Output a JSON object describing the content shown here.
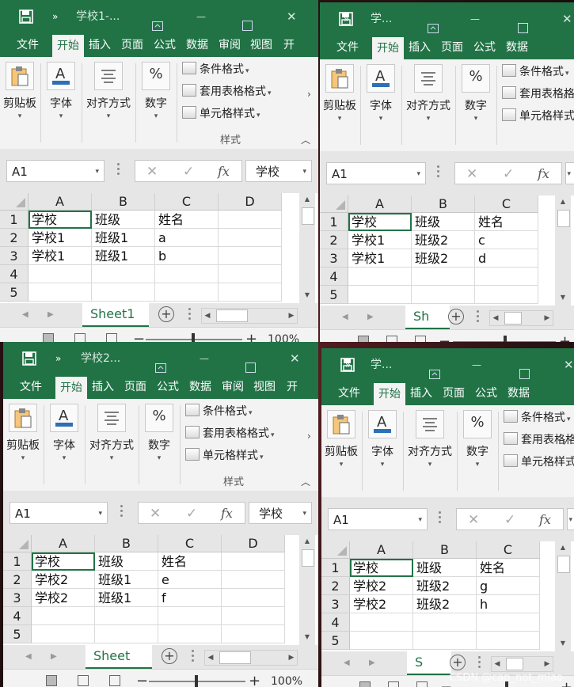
{
  "tabs": [
    "文件",
    "开始",
    "插入",
    "页面",
    "公式",
    "数据",
    "审阅",
    "视图",
    "开"
  ],
  "ribbon": {
    "clipboard": "剪贴板",
    "font": "字体",
    "alignment": "对齐方式",
    "number": "数字",
    "cond_format": "条件格式",
    "table_format": "套用表格格式",
    "cell_style": "单元格样式",
    "styles_group": "样式"
  },
  "formula_bar": {
    "name_box": "A1",
    "content": "学校",
    "fx": "fx"
  },
  "columns": [
    "A",
    "B",
    "C",
    "D"
  ],
  "rows": [
    "1",
    "2",
    "3",
    "4",
    "5"
  ],
  "status": {
    "zoom": "100%"
  },
  "windows": [
    {
      "title": "学校1-...",
      "sheet": "Sheet1",
      "cells": [
        [
          "学校",
          "班级",
          "姓名"
        ],
        [
          "学校1",
          "班级1",
          "a"
        ],
        [
          "学校1",
          "班级1",
          "b"
        ]
      ]
    },
    {
      "title": "学...",
      "sheet": "Sh",
      "cells": [
        [
          "学校",
          "班级",
          "姓名"
        ],
        [
          "学校1",
          "班级2",
          "c"
        ],
        [
          "学校1",
          "班级2",
          "d"
        ]
      ]
    },
    {
      "title": "学校2...",
      "sheet": "Sheet",
      "cells": [
        [
          "学校",
          "班级",
          "姓名"
        ],
        [
          "学校2",
          "班级1",
          "e"
        ],
        [
          "学校2",
          "班级1",
          "f"
        ]
      ]
    },
    {
      "title": "学...",
      "sheet": "S",
      "cells": [
        [
          "学校",
          "班级",
          "姓名"
        ],
        [
          "学校2",
          "班级2",
          "g"
        ],
        [
          "学校2",
          "班级2",
          "h"
        ]
      ]
    }
  ],
  "watermark": "CSDN @can_not_miao",
  "colors": {
    "excel_green": "#217346",
    "chrome_bg": "#e6e6e6"
  }
}
